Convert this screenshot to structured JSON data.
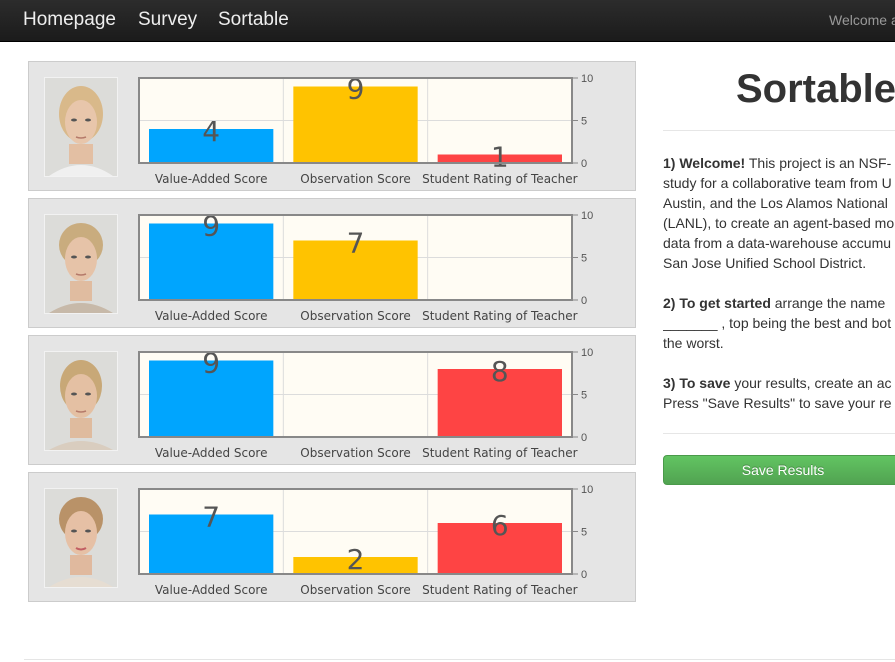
{
  "nav": {
    "links": [
      "Homepage",
      "Survey",
      "Sortable"
    ],
    "welcome": "Welcome a"
  },
  "colors": {
    "value_added": "#00a5fe",
    "observation": "#ffc300",
    "student_rating": "#fe4444"
  },
  "chart_data": [
    {
      "type": "bar",
      "categories": [
        "Value-Added Score",
        "Observation Score",
        "Student Rating of Teacher"
      ],
      "values": [
        4,
        9,
        1
      ],
      "ylim": [
        0,
        10
      ],
      "yticks": [
        0,
        5,
        10
      ],
      "grid": true
    },
    {
      "type": "bar",
      "categories": [
        "Value-Added Score",
        "Observation Score",
        "Student Rating of Teacher"
      ],
      "values": [
        9,
        7,
        null
      ],
      "ylim": [
        0,
        10
      ],
      "yticks": [
        0,
        5,
        10
      ],
      "grid": true
    },
    {
      "type": "bar",
      "categories": [
        "Value-Added Score",
        "Observation Score",
        "Student Rating of Teacher"
      ],
      "values": [
        9,
        null,
        8
      ],
      "ylim": [
        0,
        10
      ],
      "yticks": [
        0,
        5,
        10
      ],
      "grid": true
    },
    {
      "type": "bar",
      "categories": [
        "Value-Added Score",
        "Observation Score",
        "Student Rating of Teacher"
      ],
      "values": [
        7,
        2,
        6
      ],
      "ylim": [
        0,
        10
      ],
      "yticks": [
        0,
        5,
        10
      ],
      "grid": true
    }
  ],
  "sidebar": {
    "title": "Sortable",
    "step1": {
      "heading": "1) Welcome!",
      "lines": [
        " This project is an NSF-",
        "study for a collaborative team from U",
        "Austin, and the Los Alamos National ",
        "(LANL), to create an agent-based mo",
        "data from a data-warehouse accumu",
        "San Jose Unified School District."
      ]
    },
    "step2": {
      "heading": "2) To get started",
      "lines": [
        " arrange the name",
        "_______ , top being the best and bot",
        "the worst."
      ]
    },
    "step3": {
      "heading": "3) To save",
      "lines": [
        " your results, create an ac",
        "Press \"Save Results\" to save your re"
      ]
    },
    "save_button": "Save Results"
  }
}
